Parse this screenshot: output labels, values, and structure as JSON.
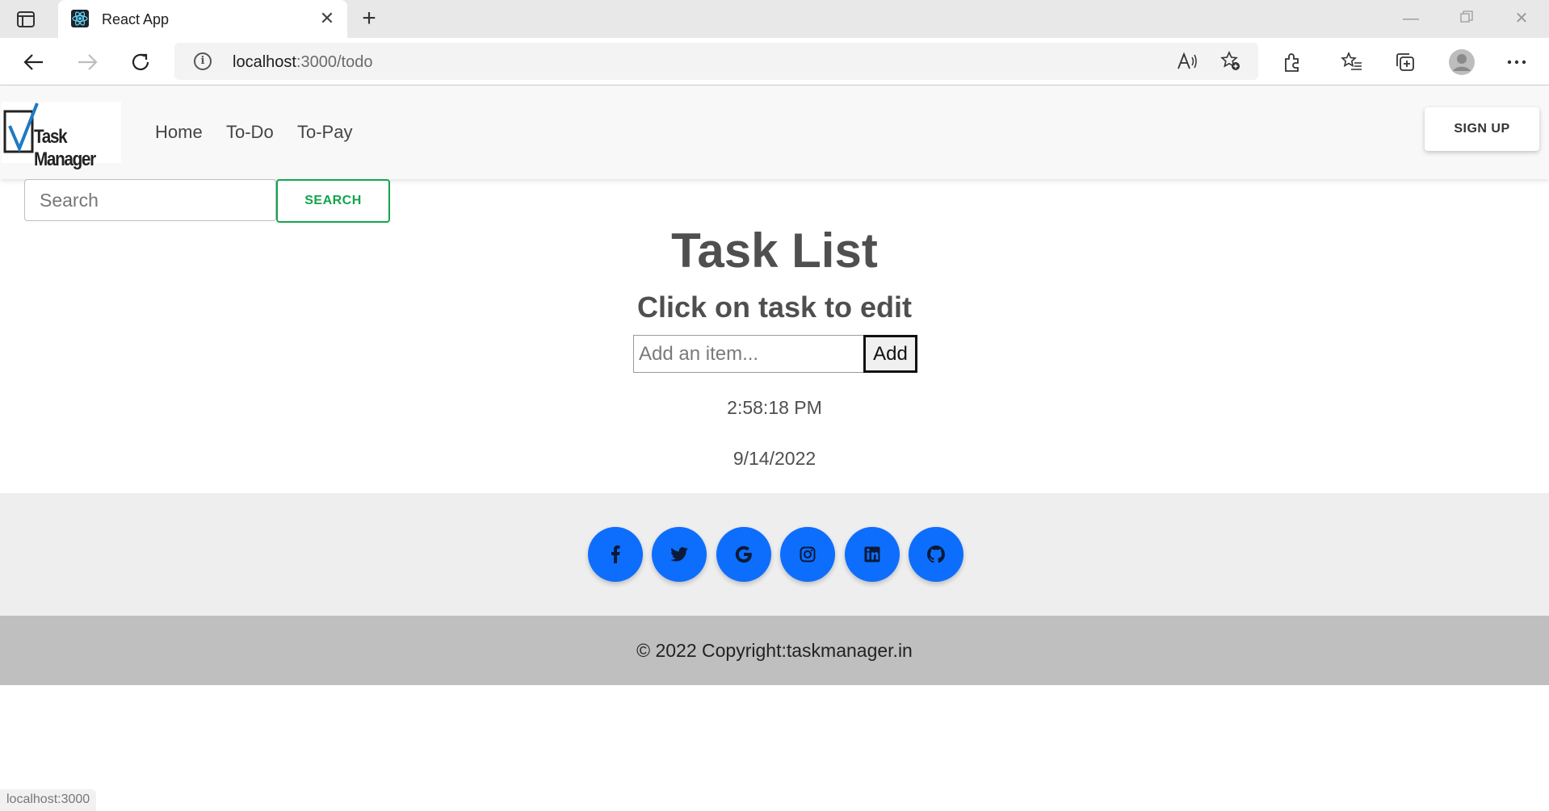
{
  "browser": {
    "tab_title": "React App",
    "url_host": "localhost",
    "url_path": ":3000/todo",
    "status_url": "localhost:3000"
  },
  "navbar": {
    "brand": "Task Manager",
    "links": [
      "Home",
      "To-Do",
      "To-Pay"
    ],
    "signup_label": "SIGN UP"
  },
  "search": {
    "placeholder": "Search",
    "button_label": "SEARCH"
  },
  "main": {
    "title": "Task List",
    "subtitle": "Click on task to edit",
    "add_placeholder": "Add an item...",
    "add_label": "Add",
    "time": "2:58:18 PM",
    "date": "9/14/2022"
  },
  "footer": {
    "social_icons": [
      "facebook-icon",
      "twitter-icon",
      "google-icon",
      "instagram-icon",
      "linkedin-icon",
      "github-icon"
    ],
    "copyright": "© 2022 Copyright:taskmanager.in"
  },
  "colors": {
    "accent_blue": "#0d6efd",
    "accent_green": "#14a44d",
    "footer_top": "#eeeeee",
    "footer_bottom": "#bfbfbf"
  }
}
